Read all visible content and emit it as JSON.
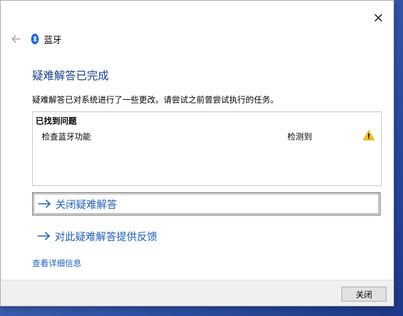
{
  "window": {
    "nav_title": "蓝牙"
  },
  "main": {
    "heading": "疑难解答已完成",
    "description": "疑难解答已对系统进行了一些更改。请尝试之前曾尝试执行的任务。"
  },
  "problems": {
    "title": "已找到问题",
    "items": [
      {
        "name": "检查蓝牙功能",
        "status": "检测到",
        "icon": "warning-icon"
      }
    ]
  },
  "actions": {
    "close_troubleshooter": "关闭疑难解答",
    "feedback": "对此疑难解答提供反馈",
    "view_details": "查看详细信息"
  },
  "footer": {
    "close_label": "关闭"
  },
  "colors": {
    "heading": "#1a3f8f",
    "link": "#1f5fbf",
    "warning": "#f5c400"
  }
}
